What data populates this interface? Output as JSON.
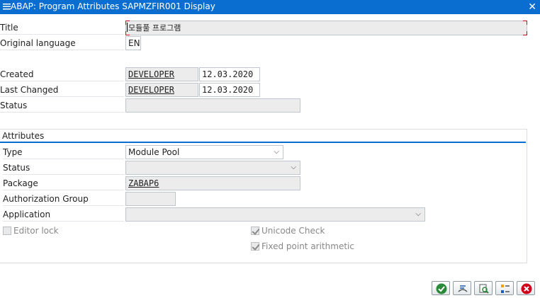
{
  "window": {
    "title": "ABAP: Program Attributes SAPMZFIR001 Display",
    "close_icon": "close-icon"
  },
  "header_fields": {
    "title": {
      "label": "Title",
      "value": "모듈풀 프로그램"
    },
    "original_language": {
      "label": "Original language",
      "value": "EN"
    },
    "created": {
      "label": "Created",
      "user": "DEVELOPER",
      "date": "12.03.2020"
    },
    "last_changed": {
      "label": "Last Changed",
      "user": "DEVELOPER",
      "date": "12.03.2020"
    },
    "status": {
      "label": "Status",
      "value": ""
    }
  },
  "attributes": {
    "group_title": "Attributes",
    "type": {
      "label": "Type",
      "value": "Module Pool"
    },
    "status": {
      "label": "Status",
      "value": ""
    },
    "package": {
      "label": "Package",
      "value": "ZABAP6"
    },
    "authorization_group": {
      "label": "Authorization Group",
      "value": ""
    },
    "application": {
      "label": "Application",
      "value": ""
    },
    "editor_lock": {
      "label": "Editor lock",
      "checked": false
    },
    "unicode_check": {
      "label": "Unicode Check",
      "checked": true
    },
    "fixed_point": {
      "label": "Fixed point arithmetic",
      "checked": true
    }
  },
  "toolbar": {
    "buttons": [
      {
        "name": "confirm-button",
        "icon": "check-icon"
      },
      {
        "name": "texts-button",
        "icon": "text-elements-icon"
      },
      {
        "name": "where-used-button",
        "icon": "search-list-icon"
      },
      {
        "name": "display-object-button",
        "icon": "object-list-icon"
      },
      {
        "name": "cancel-button",
        "icon": "cancel-icon"
      }
    ]
  },
  "colors": {
    "title_bar": "#0a6ed1",
    "accent_line": "#0a6ed1",
    "required_corner": "#d0021b",
    "ok_green": "#2a8a3a",
    "cancel_red": "#d0021b"
  }
}
